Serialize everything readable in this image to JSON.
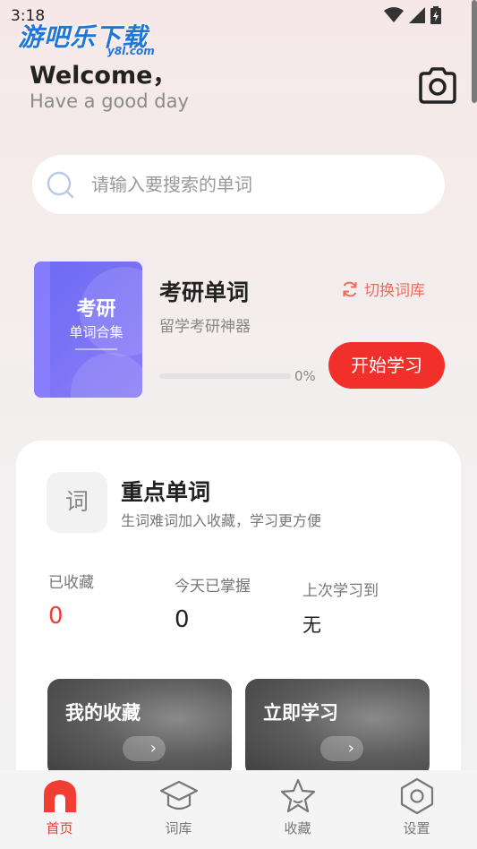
{
  "status_bar": {
    "time": "3:18"
  },
  "watermark": {
    "main": "游吧乐下载",
    "sub": "y8l.com"
  },
  "header": {
    "welcome": "Welcome，",
    "subtitle": "Have a good day"
  },
  "search": {
    "placeholder": "请输入要搜索的单词"
  },
  "deck": {
    "cover_title": "考研",
    "cover_subtitle": "单词合集",
    "name": "考研单词",
    "description": "留学考研神器",
    "switch_label": "切换词库",
    "progress_percent": 0,
    "progress_text": "0%",
    "start_label": "开始学习"
  },
  "key_words": {
    "icon_char": "词",
    "title": "重点单词",
    "subtitle": "生词难词加入收藏，学习更方便",
    "stats": [
      {
        "label": "已收藏",
        "value": "0"
      },
      {
        "label": "今天已掌握",
        "value": "0"
      },
      {
        "label": "上次学习到",
        "value": "无"
      }
    ],
    "tiles": [
      {
        "title": "我的收藏",
        "arrow": "›"
      },
      {
        "title": "立即学习",
        "arrow": "›"
      }
    ]
  },
  "tabs": [
    {
      "label": "首页",
      "icon": "home-icon",
      "active": true
    },
    {
      "label": "词库",
      "icon": "graduation-cap-icon",
      "active": false
    },
    {
      "label": "收藏",
      "icon": "star-icon",
      "active": false
    },
    {
      "label": "设置",
      "icon": "settings-icon",
      "active": false
    }
  ],
  "colors": {
    "accent": "#f13d34",
    "book": "#6d6af5",
    "switch": "#f06a5e"
  }
}
